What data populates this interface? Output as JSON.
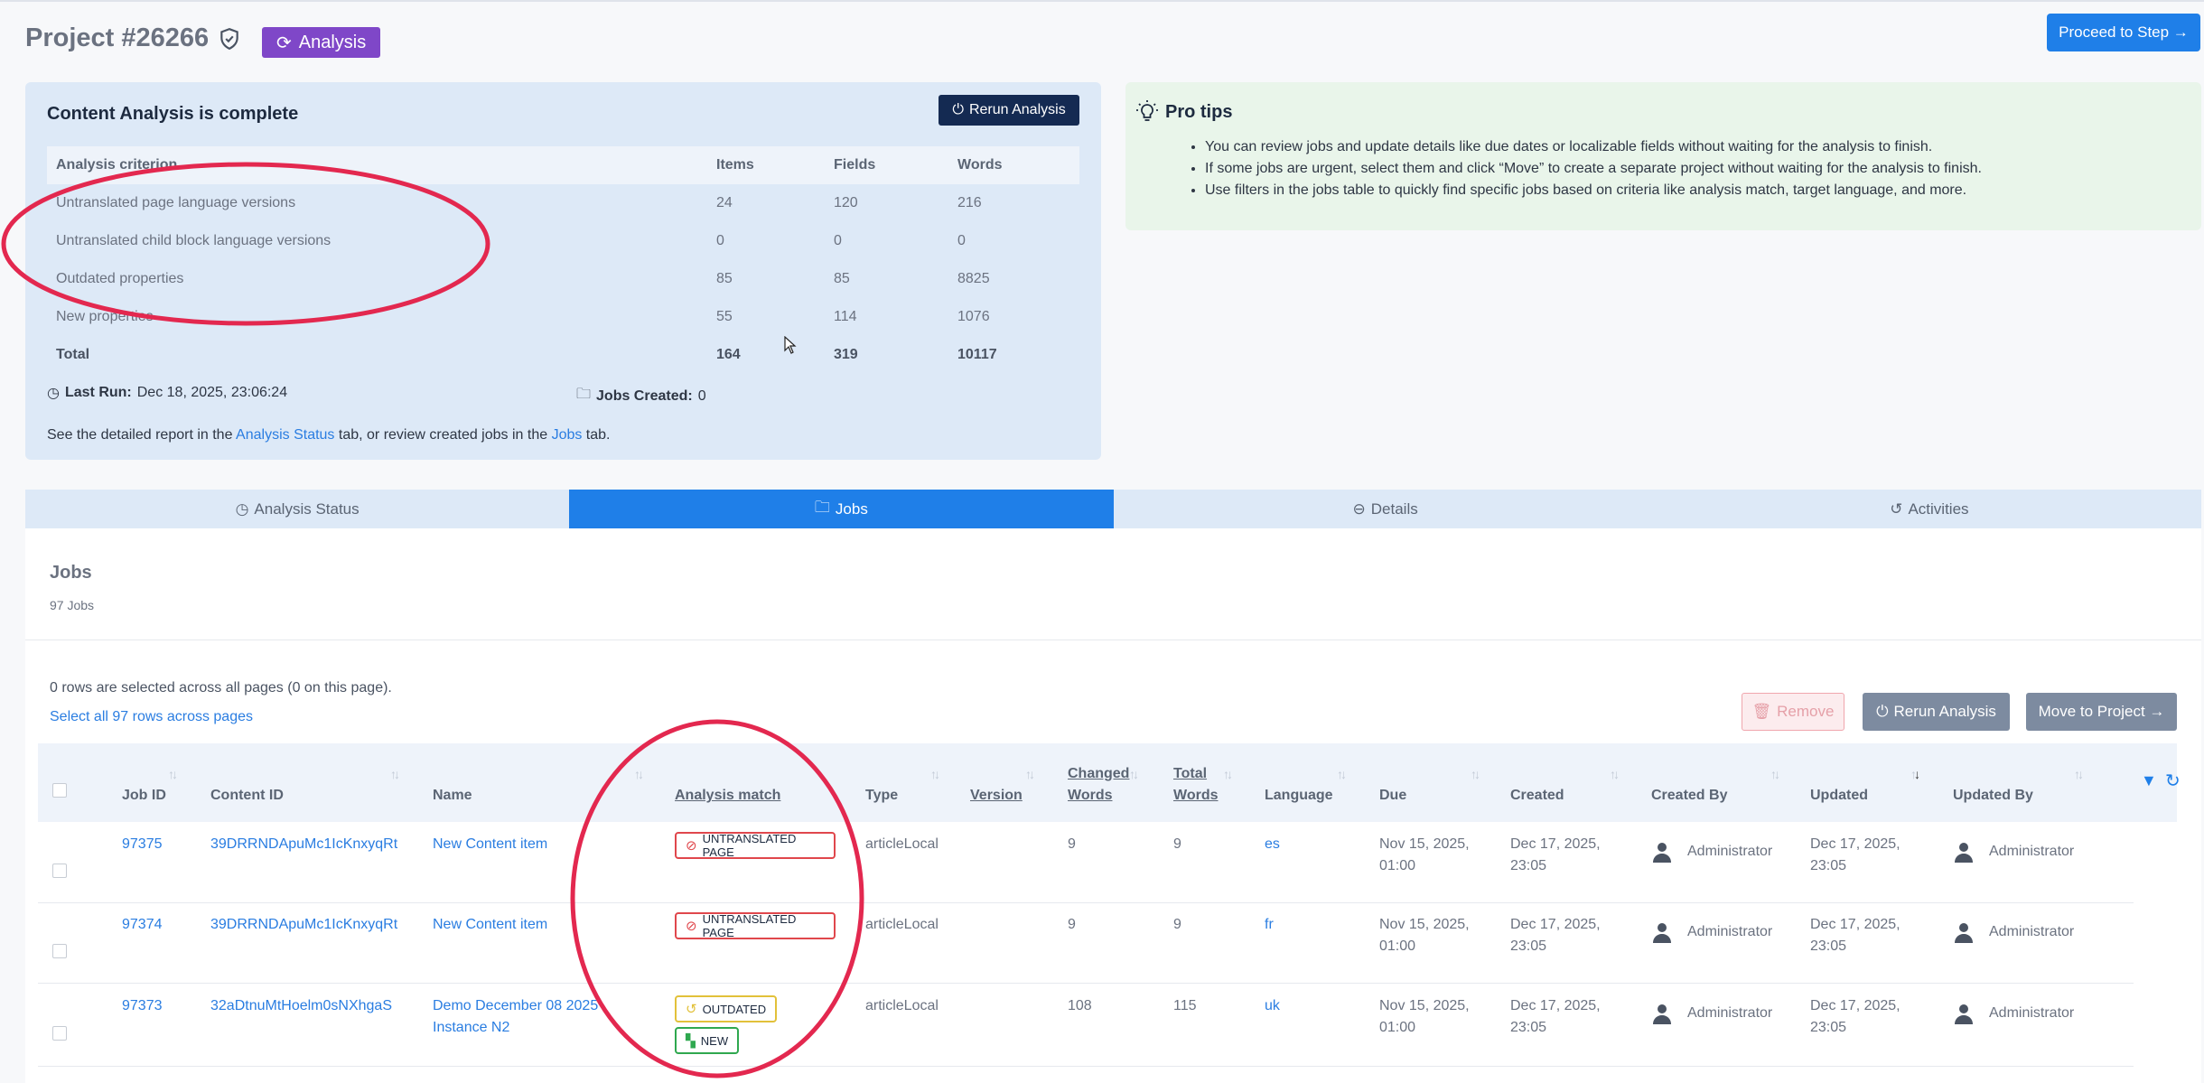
{
  "header": {
    "project_title": "Project #26266",
    "status_badge": "Analysis",
    "proceed_button": "Proceed to Step →"
  },
  "analysis": {
    "title": "Content Analysis is complete",
    "rerun_button": "Rerun Analysis",
    "columns": [
      "Analysis criterion",
      "Items",
      "Fields",
      "Words"
    ],
    "rows": [
      {
        "criterion": "Untranslated page language versions",
        "items": "24",
        "fields": "120",
        "words": "216"
      },
      {
        "criterion": "Untranslated child block language versions",
        "items": "0",
        "fields": "0",
        "words": "0"
      },
      {
        "criterion": "Outdated properties",
        "items": "85",
        "fields": "85",
        "words": "8825"
      },
      {
        "criterion": "New properties",
        "items": "55",
        "fields": "114",
        "words": "1076"
      },
      {
        "criterion": "Total",
        "items": "164",
        "fields": "319",
        "words": "10117"
      }
    ],
    "last_run_label": "Last Run:",
    "last_run_value": "Dec 18, 2025, 23:06:24",
    "jobs_created_label": "Jobs Created:",
    "jobs_created_value": "0",
    "see_prefix": "See the detailed report in the ",
    "see_link1": "Analysis Status",
    "see_middle": " tab, or review created jobs in the ",
    "see_link2": "Jobs",
    "see_suffix": " tab."
  },
  "tips": {
    "title": "Pro tips",
    "items": [
      "You can review jobs and update details like due dates or localizable fields without waiting for the analysis to finish.",
      "If some jobs are urgent, select them and click “Move” to create a separate project without waiting for the analysis to finish.",
      "Use filters in the jobs table to quickly find specific jobs based on criteria like analysis match, target language, and more."
    ]
  },
  "tabs": [
    {
      "label": "Analysis Status",
      "icon": "clock-icon"
    },
    {
      "label": "Jobs",
      "icon": "briefcase-icon"
    },
    {
      "label": "Details",
      "icon": "minus-circle-icon"
    },
    {
      "label": "Activities",
      "icon": "history-icon"
    }
  ],
  "jobs": {
    "title": "Jobs",
    "count": "97 Jobs",
    "selection_info": "0 rows are selected across all pages (0 on this page).",
    "select_all": "Select all 97 rows across pages",
    "remove_button": "Remove",
    "rerun_button": "Rerun Analysis",
    "move_button": "Move to Project →",
    "headers": {
      "job_id": "Job ID",
      "content_id": "Content ID",
      "name": "Name",
      "analysis_match": "Analysis match",
      "type": "Type",
      "version": "Version",
      "changed_1": "Changed",
      "changed_2": "Words",
      "total_1": "Total",
      "total_2": "Words",
      "language": "Language",
      "due": "Due",
      "created": "Created",
      "created_by": "Created By",
      "updated": "Updated",
      "updated_by": "Updated By"
    },
    "rows": [
      {
        "job_id": "97375",
        "content_id": "39DRRNDApuMc1IcKnxyqRt",
        "name_1": "New Content item",
        "name_2": "",
        "match": [
          "UNTRANSLATED PAGE"
        ],
        "type": "articleLocal",
        "changed": "9",
        "total": "9",
        "language": "es",
        "due_1": "Nov 15, 2025,",
        "due_2": "01:00",
        "created_1": "Dec 17, 2025,",
        "created_2": "23:05",
        "created_by": "Administrator",
        "updated_1": "Dec 17, 2025,",
        "updated_2": "23:05",
        "updated_by": "Administrator"
      },
      {
        "job_id": "97374",
        "content_id": "39DRRNDApuMc1IcKnxyqRt",
        "name_1": "New Content item",
        "name_2": "",
        "match": [
          "UNTRANSLATED PAGE"
        ],
        "type": "articleLocal",
        "changed": "9",
        "total": "9",
        "language": "fr",
        "due_1": "Nov 15, 2025,",
        "due_2": "01:00",
        "created_1": "Dec 17, 2025,",
        "created_2": "23:05",
        "created_by": "Administrator",
        "updated_1": "Dec 17, 2025,",
        "updated_2": "23:05",
        "updated_by": "Administrator"
      },
      {
        "job_id": "97373",
        "content_id": "32aDtnuMtHoelm0sNXhgaS",
        "name_1": "Demo December 08 2025",
        "name_2": "Instance N2",
        "match": [
          "OUTDATED",
          "NEW"
        ],
        "type": "articleLocal",
        "changed": "108",
        "total": "115",
        "language": "uk",
        "due_1": "Nov 15, 2025,",
        "due_2": "01:00",
        "created_1": "Dec 17, 2025,",
        "created_2": "23:05",
        "created_by": "Administrator",
        "updated_1": "Dec 17, 2025,",
        "updated_2": "23:05",
        "updated_by": "Administrator"
      }
    ]
  },
  "colors": {
    "primary": "#1f7fe8",
    "analysis_badge": "#7f47c8",
    "annotation": "#e3284f",
    "untranslated": "#e0474c",
    "outdated": "#e2c13a",
    "new": "#2fa84f"
  }
}
